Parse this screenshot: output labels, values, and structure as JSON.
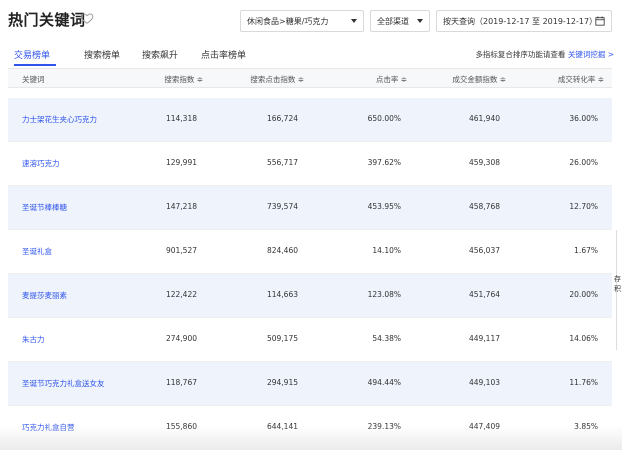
{
  "header": {
    "title": "热门关键词",
    "category": "休闲食品>糖果/巧克力",
    "channel": "全部渠道",
    "date_range": "按天查询（2019-12-17 至 2019-12-17）"
  },
  "tabs": [
    {
      "label": "交易榜单",
      "active": true
    },
    {
      "label": "搜索榜单",
      "active": false
    },
    {
      "label": "搜索飙升",
      "active": false
    },
    {
      "label": "点击率榜单",
      "active": false
    }
  ],
  "hint": {
    "text": "多指标复合排序功能请查看",
    "link": "关键词挖掘 >"
  },
  "table": {
    "columns": [
      "关键词",
      "搜索指数 ≑",
      "搜索点击指数 ≑",
      "点击率 ≑",
      "成交金额指数 ≑",
      "成交转化率 ≑"
    ],
    "rows": [
      {
        "keyword": "力士架花生夹心巧克力",
        "search_index": "114,318",
        "click_index": "166,724",
        "ctr": "650.00%",
        "gmv_index": "461,940",
        "cvr": "36.00%"
      },
      {
        "keyword": "速溶巧克力",
        "search_index": "129,991",
        "click_index": "556,717",
        "ctr": "397.62%",
        "gmv_index": "459,308",
        "cvr": "26.00%"
      },
      {
        "keyword": "圣诞节棒棒糖",
        "search_index": "147,218",
        "click_index": "739,574",
        "ctr": "453.95%",
        "gmv_index": "458,768",
        "cvr": "12.70%"
      },
      {
        "keyword": "圣诞礼盒",
        "search_index": "901,527",
        "click_index": "824,460",
        "ctr": "14.10%",
        "gmv_index": "456,037",
        "cvr": "1.67%"
      },
      {
        "keyword": "麦提莎麦丽素",
        "search_index": "122,422",
        "click_index": "114,663",
        "ctr": "123.08%",
        "gmv_index": "451,764",
        "cvr": "20.00%"
      },
      {
        "keyword": "朱古力",
        "search_index": "274,900",
        "click_index": "509,175",
        "ctr": "54.38%",
        "gmv_index": "449,117",
        "cvr": "14.06%"
      },
      {
        "keyword": "圣诞节巧克力礼盒送女友",
        "search_index": "118,767",
        "click_index": "294,915",
        "ctr": "494.44%",
        "gmv_index": "449,103",
        "cvr": "11.76%"
      },
      {
        "keyword": "巧克力礼盒自营",
        "search_index": "155,860",
        "click_index": "644,141",
        "ctr": "239.13%",
        "gmv_index": "447,409",
        "cvr": "3.85%"
      }
    ]
  },
  "edge_chars": [
    "存",
    "积"
  ],
  "colors": {
    "accent": "#2f54eb",
    "stripe": "#eef3fc",
    "header_bg": "#f7f8fa"
  }
}
